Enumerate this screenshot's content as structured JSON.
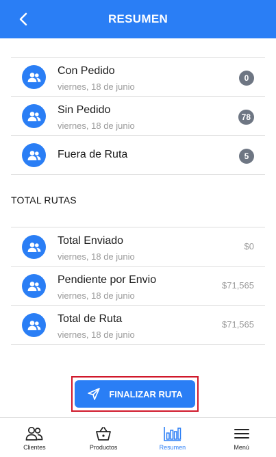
{
  "header": {
    "title": "RESUMEN",
    "back_icon": "chevron-left-icon"
  },
  "colors": {
    "primary": "#2a7ef5",
    "badge": "#6e7683",
    "highlight_border": "#d0182a"
  },
  "orders": [
    {
      "title": "Con Pedido",
      "date": "viernes, 18 de junio",
      "count": "0"
    },
    {
      "title": "Sin Pedido",
      "date": "viernes, 18 de junio",
      "count": "78"
    },
    {
      "title": "Fuera de Ruta",
      "count": "5"
    }
  ],
  "totals_heading": "TOTAL RUTAS",
  "totals": [
    {
      "title": "Total Enviado",
      "date": "viernes, 18 de junio",
      "amount": "$0"
    },
    {
      "title": "Pendiente por Envio",
      "date": "viernes, 18 de junio",
      "amount": "$71,565"
    },
    {
      "title": "Total de Ruta",
      "date": "viernes, 18 de junio",
      "amount": "$71,565"
    }
  ],
  "finalize": {
    "label": "FINALIZAR RUTA",
    "icon": "send-icon"
  },
  "tabs": [
    {
      "label": "Clientes",
      "icon": "users-icon",
      "active": false
    },
    {
      "label": "Productos",
      "icon": "basket-icon",
      "active": false
    },
    {
      "label": "Resumen",
      "icon": "bar-chart-icon",
      "active": true
    },
    {
      "label": "Menú",
      "icon": "menu-icon",
      "active": false
    }
  ]
}
